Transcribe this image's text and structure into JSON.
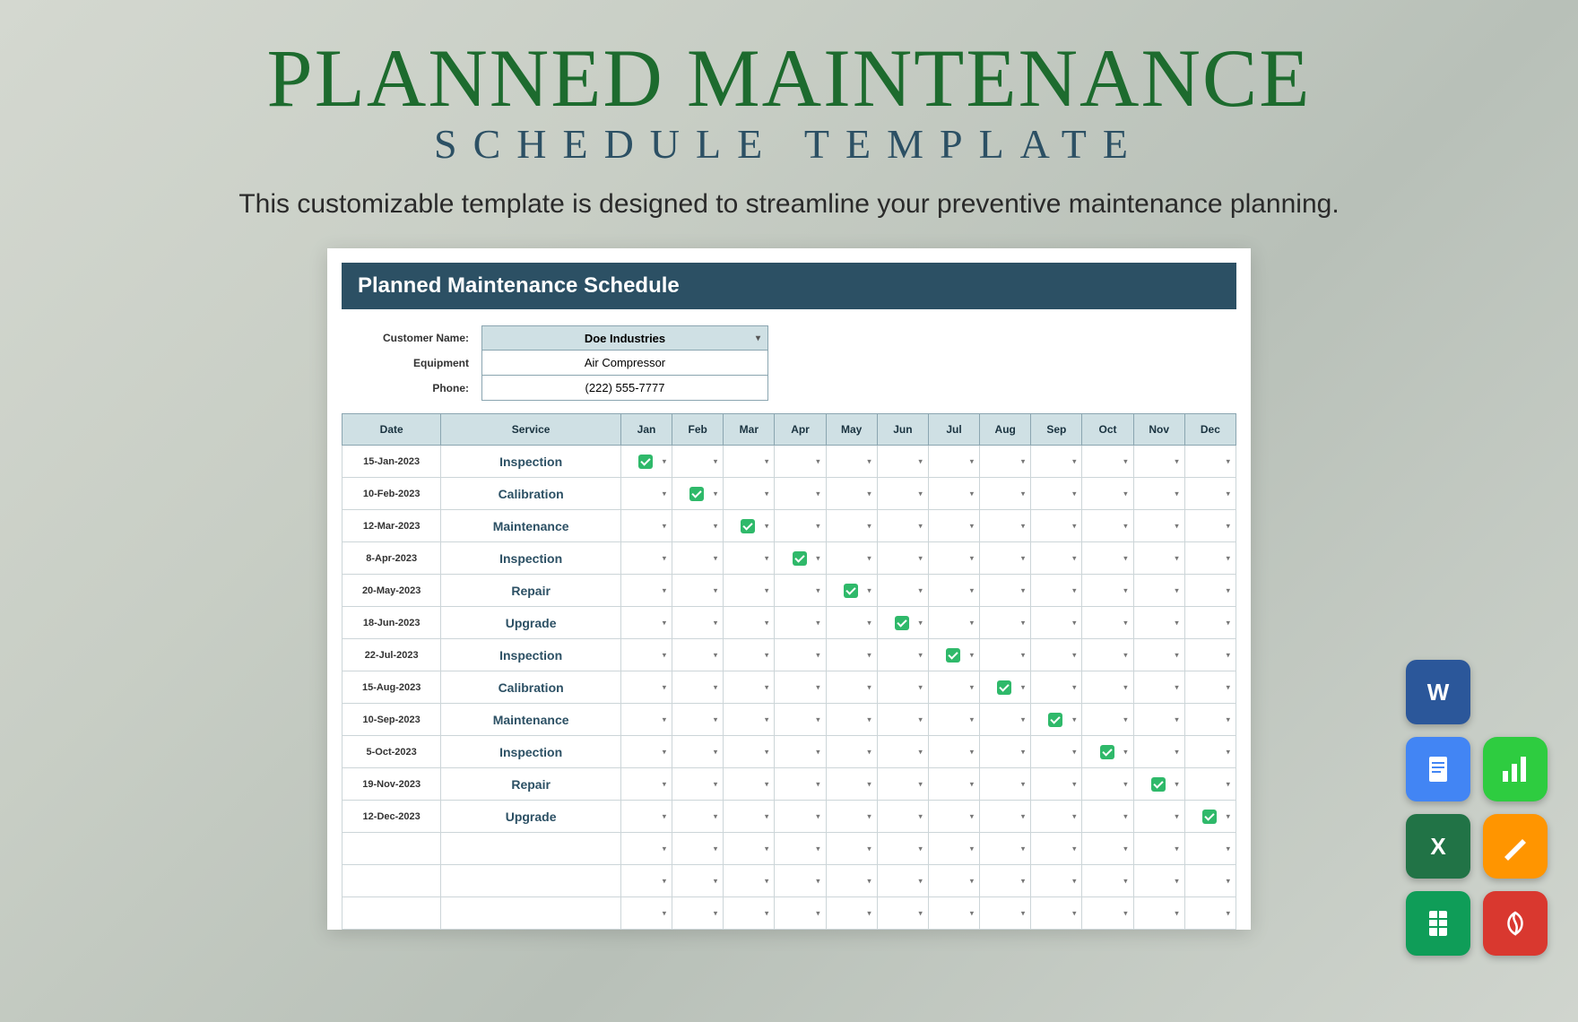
{
  "hero": {
    "title_main": "PLANNED MAINTENANCE",
    "title_sub": "SCHEDULE TEMPLATE",
    "tagline": "This customizable template is designed to streamline your preventive maintenance planning."
  },
  "sheet": {
    "header": "Planned Maintenance Schedule",
    "meta": {
      "customer_label": "Customer Name:",
      "customer_value": "Doe Industries",
      "equipment_label": "Equipment",
      "equipment_value": "Air Compressor",
      "phone_label": "Phone:",
      "phone_value": "(222) 555-7777"
    },
    "columns": {
      "date": "Date",
      "service": "Service",
      "months": [
        "Jan",
        "Feb",
        "Mar",
        "Apr",
        "May",
        "Jun",
        "Jul",
        "Aug",
        "Sep",
        "Oct",
        "Nov",
        "Dec"
      ]
    },
    "rows": [
      {
        "date": "15-Jan-2023",
        "service": "Inspection",
        "checked": 0
      },
      {
        "date": "10-Feb-2023",
        "service": "Calibration",
        "checked": 1
      },
      {
        "date": "12-Mar-2023",
        "service": "Maintenance",
        "checked": 2
      },
      {
        "date": "8-Apr-2023",
        "service": "Inspection",
        "checked": 3
      },
      {
        "date": "20-May-2023",
        "service": "Repair",
        "checked": 4
      },
      {
        "date": "18-Jun-2023",
        "service": "Upgrade",
        "checked": 5
      },
      {
        "date": "22-Jul-2023",
        "service": "Inspection",
        "checked": 6
      },
      {
        "date": "15-Aug-2023",
        "service": "Calibration",
        "checked": 7
      },
      {
        "date": "10-Sep-2023",
        "service": "Maintenance",
        "checked": 8
      },
      {
        "date": "5-Oct-2023",
        "service": "Inspection",
        "checked": 9
      },
      {
        "date": "19-Nov-2023",
        "service": "Repair",
        "checked": 10
      },
      {
        "date": "12-Dec-2023",
        "service": "Upgrade",
        "checked": 11
      }
    ],
    "empty_rows": 3
  },
  "apps": {
    "word": "W",
    "numbers": "",
    "docs": "",
    "pages": "",
    "excel": "X",
    "pdf": "",
    "sheets": ""
  }
}
